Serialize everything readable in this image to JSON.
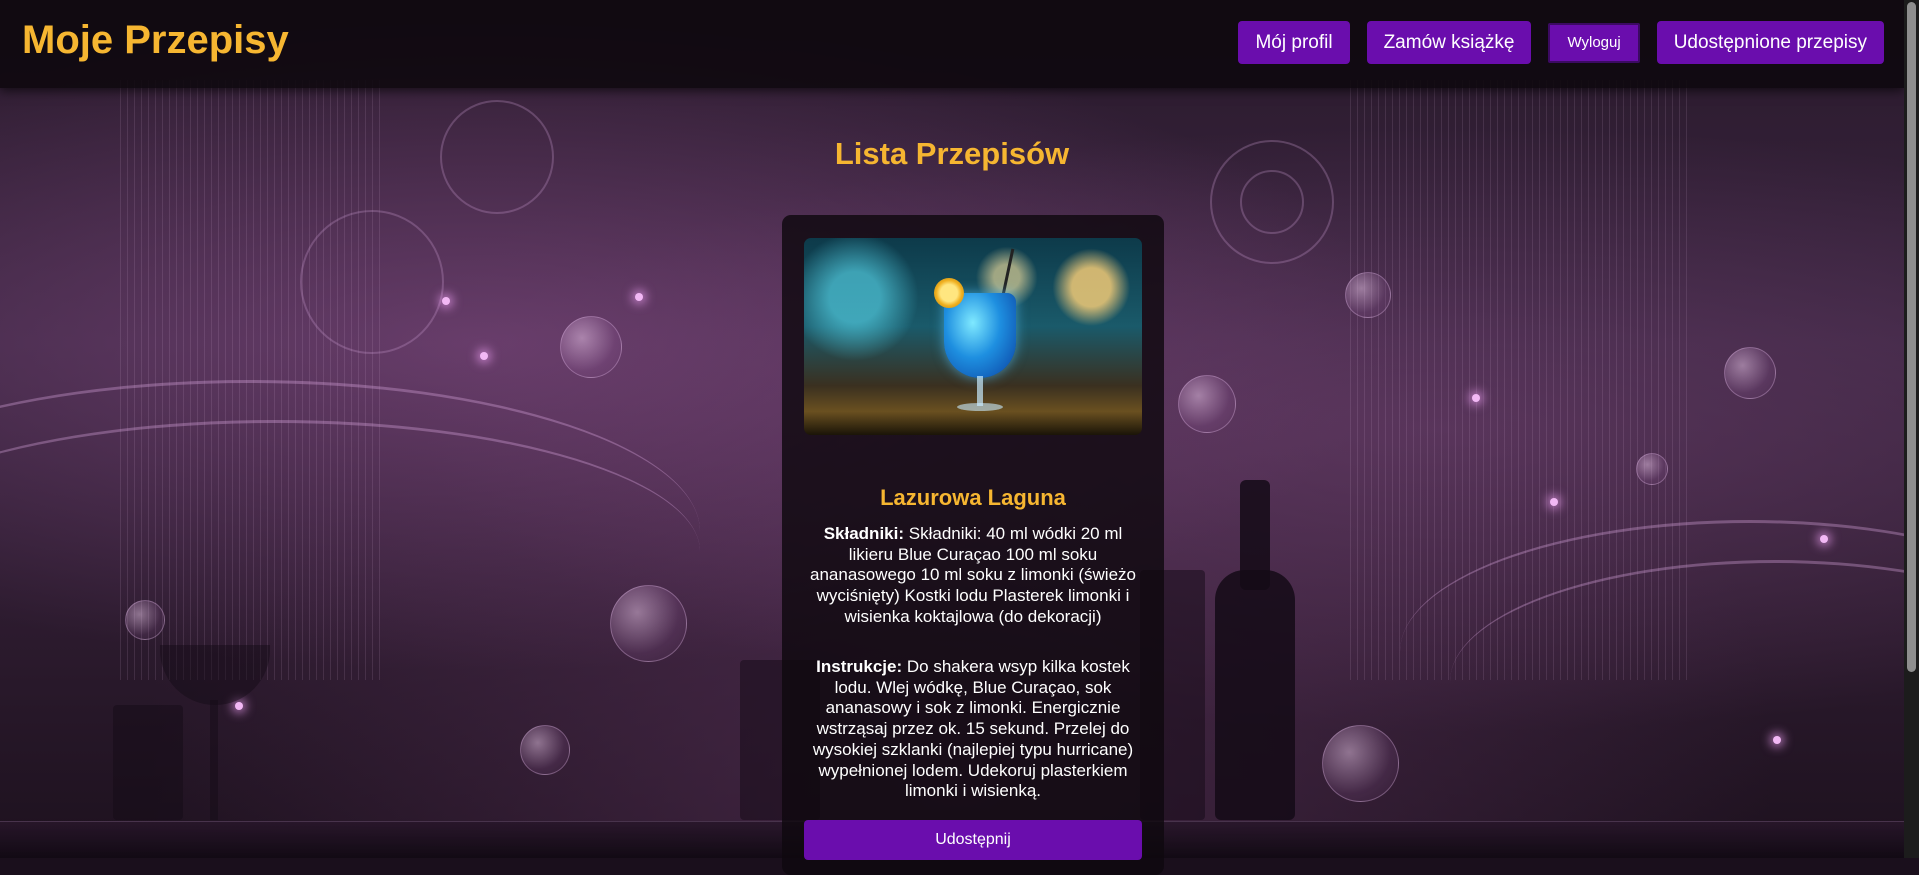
{
  "header": {
    "logo": "Moje Przepisy",
    "nav": {
      "profile": "Mój profil",
      "order_book": "Zamów książkę",
      "logout": "Wyloguj",
      "shared": "Udostępnione przepisy"
    }
  },
  "main": {
    "title": "Lista Przepisów",
    "recipe": {
      "name": "Lazurowa Laguna",
      "ingredients_label": "Składniki:",
      "ingredients": "Składniki: 40 ml wódki 20 ml likieru Blue Curaçao 100 ml soku ananasowego 10 ml soku z limonki (świeżo wyciśnięty) Kostki lodu Plasterek limonki i wisienka koktajlowa (do dekoracji)",
      "instructions_label": "Instrukcje:",
      "instructions": "Do shakera wsyp kilka kostek lodu. Wlej wódkę, Blue Curaçao, sok ananasowy i sok z limonki. Energicznie wstrząsaj przez ok. 15 sekund. Przelej do wysokiej szklanki (najlepiej typu hurricane) wypełnionej lodem. Udekoruj plasterkiem limonki i wisienką.",
      "share_label": "Udostępnij"
    }
  },
  "colors": {
    "accent": "#f6b631",
    "button": "#6a0dad",
    "header_bg": "#0e080e"
  }
}
